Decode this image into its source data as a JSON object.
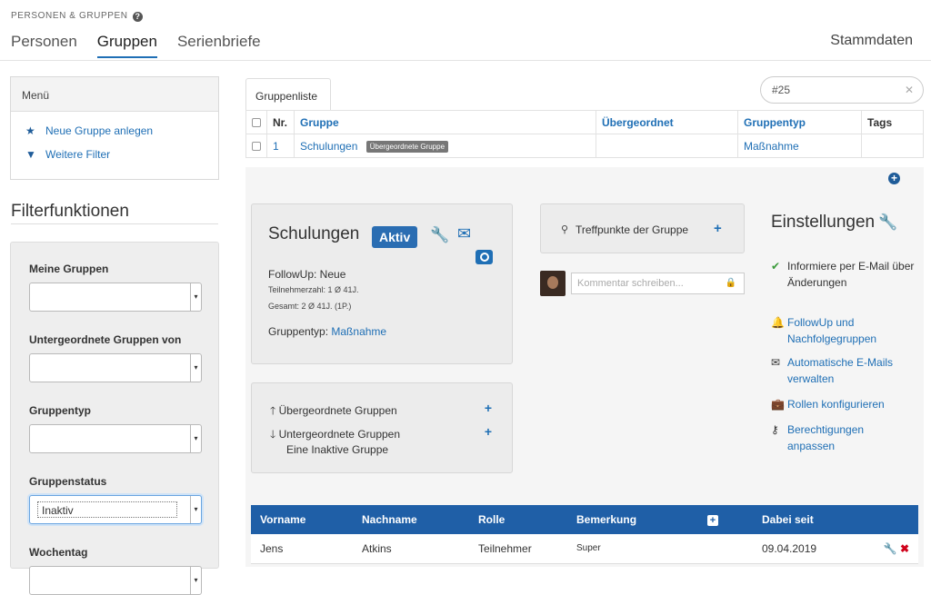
{
  "header": {
    "section_label": "PERSONEN & GRUPPEN",
    "help_icon": "?",
    "tabs": [
      {
        "label": "Personen",
        "active": false
      },
      {
        "label": "Gruppen",
        "active": true
      },
      {
        "label": "Serienbriefe",
        "active": false
      }
    ],
    "stammdaten": "Stammdaten"
  },
  "menu": {
    "title": "Menü",
    "items": [
      {
        "icon": "star-icon",
        "label": "Neue Gruppe anlegen"
      },
      {
        "icon": "filter-icon",
        "label": "Weitere Filter"
      }
    ]
  },
  "filters": {
    "title": "Filterfunktionen",
    "fields": [
      {
        "label": "Meine Gruppen",
        "value": ""
      },
      {
        "label": "Untergeordnete Gruppen von",
        "value": ""
      },
      {
        "label": "Gruppentyp",
        "value": ""
      },
      {
        "label": "Gruppenstatus",
        "value": "Inaktiv"
      },
      {
        "label": "Wochentag",
        "value": ""
      }
    ]
  },
  "grouplist": {
    "tab_label": "Gruppenliste",
    "search_value": "#25",
    "columns": [
      "Nr.",
      "Gruppe",
      "Übergeordnet",
      "Gruppentyp",
      "Tags"
    ],
    "rows": [
      {
        "nr": "1",
        "name": "Schulungen",
        "badge": "Übergeordnete Gruppe",
        "parent": "",
        "type": "Maßnahme",
        "tags": ""
      }
    ]
  },
  "group_card": {
    "name": "Schulungen",
    "status": "Aktiv",
    "followup": "FollowUp: Neue",
    "participants": "Teilnehmerzahl: 1  Ø 41J.",
    "total": "Gesamt: 2  Ø 41J. (1P.)",
    "type_label": "Gruppentyp:",
    "type_value": "Maßnahme"
  },
  "hierarchy": {
    "parent_label": "Übergeordnete Gruppen",
    "child_label": "Untergeordnete Gruppen",
    "child_group": "Eine Inaktive Gruppe"
  },
  "meeting": {
    "label": "Treffpunkte der Gruppe",
    "comment_placeholder": "Kommentar schreiben..."
  },
  "settings": {
    "title": "Einstellungen",
    "inform": "Informiere per E-Mail über Änderungen",
    "links": [
      {
        "icon": "bell-icon",
        "label": "FollowUp und Nachfolgegruppen"
      },
      {
        "icon": "envelope-icon",
        "label": "Automatische E-Mails verwalten"
      },
      {
        "icon": "briefcase-icon",
        "label": "Rollen konfigurieren"
      },
      {
        "icon": "key-icon",
        "label": "Berechtigungen anpassen"
      }
    ]
  },
  "members": {
    "columns": [
      "Vorname",
      "Nachname",
      "Rolle",
      "Bemerkung",
      "+",
      "Dabei seit"
    ],
    "rows": [
      {
        "vorname": "Jens",
        "nachname": "Atkins",
        "rolle": "Teilnehmer",
        "bemerkung": "Super",
        "seit": "09.04.2019"
      }
    ]
  },
  "colors": {
    "accent": "#1f6fb5",
    "header_blue": "#1f5fa7",
    "danger": "#d0021b"
  }
}
